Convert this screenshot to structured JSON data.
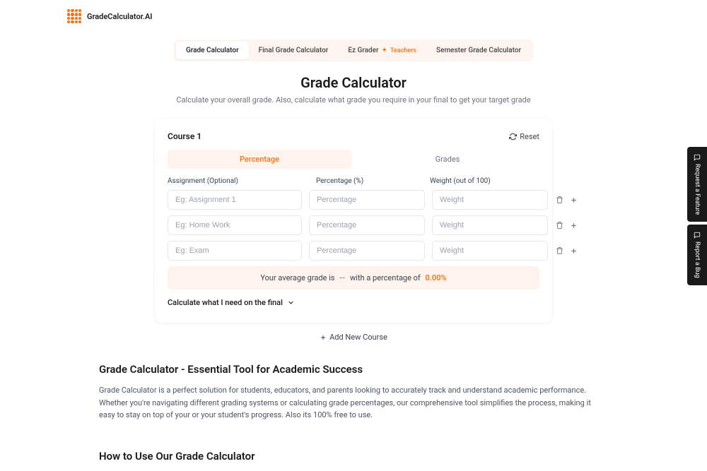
{
  "header": {
    "brand": "GradeCalculator.AI"
  },
  "nav_tabs": {
    "grade_calc": "Grade Calculator",
    "final_grade": "Final Grade Calculator",
    "ez_grader": "Ez Grader",
    "ez_badge": "Teachers",
    "semester": "Semester Grade Calculator"
  },
  "page": {
    "title": "Grade Calculator",
    "subtitle": "Calculate your overall grade. Also, calculate what grade you require in your final to get your target grade"
  },
  "course": {
    "title": "Course 1",
    "reset": "Reset",
    "mode_percentage": "Percentage",
    "mode_grades": "Grades",
    "col_assignment": "Assignment (Optional)",
    "col_percentage": "Percentage (%)",
    "col_weight": "Weight (out of 100)",
    "rows": [
      {
        "assignment_ph": "Eg: Assignment 1",
        "pct_ph": "Percentage",
        "weight_ph": "Weight"
      },
      {
        "assignment_ph": "Eg: Home Work",
        "pct_ph": "Percentage",
        "weight_ph": "Weight"
      },
      {
        "assignment_ph": "Eg: Exam",
        "pct_ph": "Percentage",
        "weight_ph": "Weight"
      }
    ],
    "result_prefix": "Your average grade is",
    "result_grade": "--",
    "result_mid": "with a percentage of",
    "result_pct": "0.00%",
    "final_calc": "Calculate what I need on the final",
    "add_course": "Add New Course"
  },
  "content": {
    "essential_title": "Grade Calculator - Essential Tool for Academic Success",
    "essential_body": "Grade Calculator is a perfect solution for students, educators, and parents looking to accurately track and understand academic performance. Whether you're navigating different grading systems or calculating grade percentages, our comprehensive tool simplifies the process, making it easy to stay on top of your or your student's progress. Also its 100% free to use.",
    "how_title": "How to Use Our Grade Calculator"
  },
  "side": {
    "feature": "Request a Feature",
    "bug": "Report a Bug"
  }
}
